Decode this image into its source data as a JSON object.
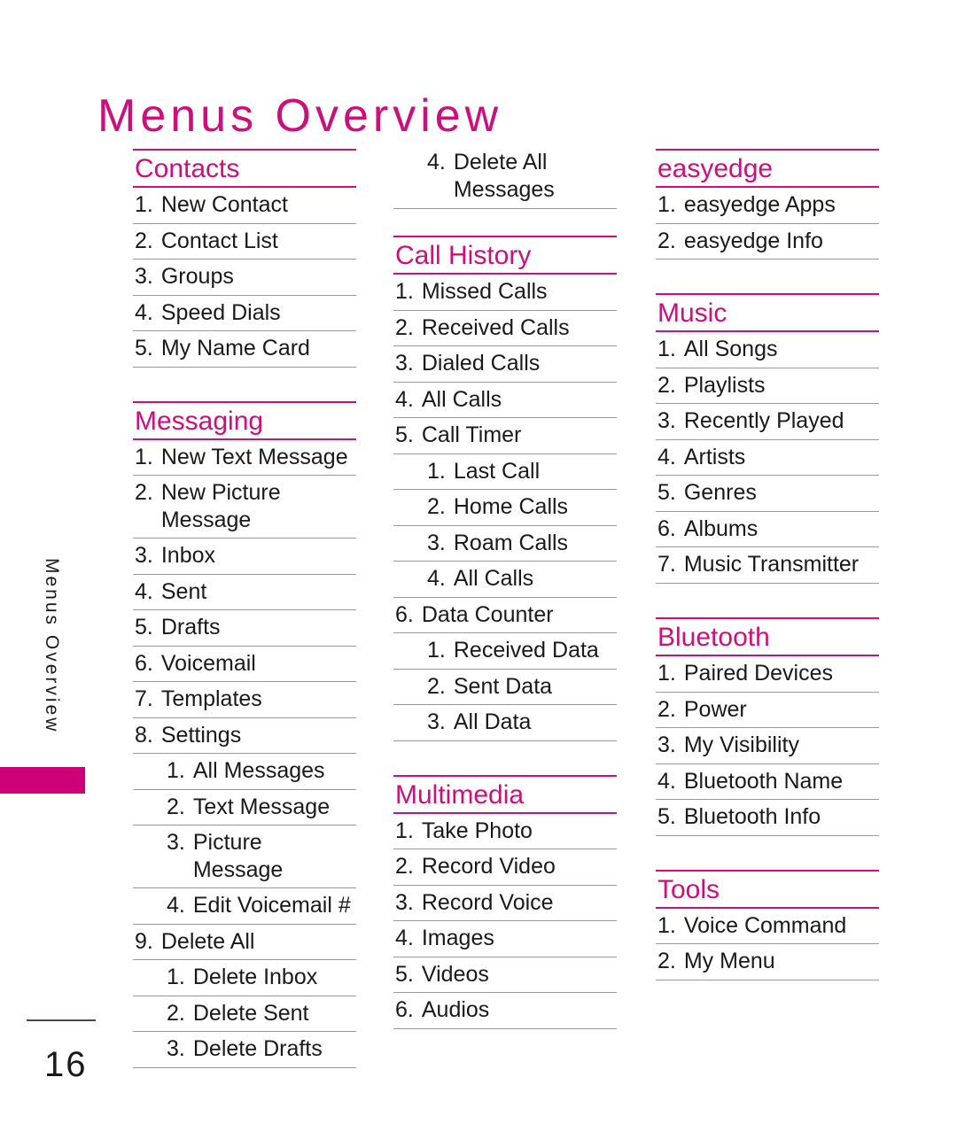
{
  "page": {
    "title": "Menus Overview",
    "side_tab_label": "Menus Overview",
    "page_number": "16",
    "accent_color": "#CE0E7D",
    "tab_color": "#CE0078",
    "rule_color": "#9a9a9a"
  },
  "columns": [
    {
      "id": "column-1",
      "groups": [
        {
          "title": "Contacts",
          "items": [
            {
              "num": "1.",
              "label": "New Contact",
              "level": 1
            },
            {
              "num": "2.",
              "label": "Contact List",
              "level": 1
            },
            {
              "num": "3.",
              "label": "Groups",
              "level": 1
            },
            {
              "num": "4.",
              "label": "Speed Dials",
              "level": 1
            },
            {
              "num": "5.",
              "label": "My Name Card",
              "level": 1
            }
          ]
        },
        {
          "title": "Messaging",
          "items": [
            {
              "num": "1.",
              "label": "New Text Message",
              "level": 1
            },
            {
              "num": "2.",
              "label": "New Picture Message",
              "level": 1
            },
            {
              "num": "3.",
              "label": "Inbox",
              "level": 1
            },
            {
              "num": "4.",
              "label": "Sent",
              "level": 1
            },
            {
              "num": "5.",
              "label": "Drafts",
              "level": 1
            },
            {
              "num": "6.",
              "label": "Voicemail",
              "level": 1
            },
            {
              "num": "7.",
              "label": "Templates",
              "level": 1
            },
            {
              "num": "8.",
              "label": "Settings",
              "level": 1
            },
            {
              "num": "1.",
              "label": "All Messages",
              "level": 2
            },
            {
              "num": "2.",
              "label": "Text Message",
              "level": 2
            },
            {
              "num": "3.",
              "label": "Picture Message",
              "level": 2
            },
            {
              "num": "4.",
              "label": "Edit Voicemail #",
              "level": 2
            },
            {
              "num": "9.",
              "label": "Delete All",
              "level": 1
            },
            {
              "num": "1.",
              "label": "Delete Inbox",
              "level": 2
            },
            {
              "num": "2.",
              "label": "Delete Sent",
              "level": 2
            },
            {
              "num": "3.",
              "label": "Delete Drafts",
              "level": 2
            }
          ]
        }
      ]
    },
    {
      "id": "column-2",
      "continued": {
        "num": "4.",
        "label": "Delete All Messages",
        "level": 2
      },
      "groups": [
        {
          "title": "Call History",
          "items": [
            {
              "num": "1.",
              "label": "Missed Calls",
              "level": 1
            },
            {
              "num": "2.",
              "label": "Received Calls",
              "level": 1
            },
            {
              "num": "3.",
              "label": "Dialed Calls",
              "level": 1
            },
            {
              "num": "4.",
              "label": "All Calls",
              "level": 1
            },
            {
              "num": "5.",
              "label": "Call Timer",
              "level": 1
            },
            {
              "num": "1.",
              "label": "Last Call",
              "level": 2
            },
            {
              "num": "2.",
              "label": "Home Calls",
              "level": 2
            },
            {
              "num": "3.",
              "label": "Roam Calls",
              "level": 2
            },
            {
              "num": "4.",
              "label": "All Calls",
              "level": 2
            },
            {
              "num": "6.",
              "label": "Data Counter",
              "level": 1
            },
            {
              "num": "1.",
              "label": "Received Data",
              "level": 2
            },
            {
              "num": "2.",
              "label": "Sent Data",
              "level": 2
            },
            {
              "num": "3.",
              "label": "All Data",
              "level": 2
            }
          ]
        },
        {
          "title": "Multimedia",
          "items": [
            {
              "num": "1.",
              "label": "Take Photo",
              "level": 1
            },
            {
              "num": "2.",
              "label": "Record Video",
              "level": 1
            },
            {
              "num": "3.",
              "label": "Record Voice",
              "level": 1
            },
            {
              "num": "4.",
              "label": "Images",
              "level": 1
            },
            {
              "num": "5.",
              "label": "Videos",
              "level": 1
            },
            {
              "num": "6.",
              "label": "Audios",
              "level": 1
            }
          ]
        }
      ]
    },
    {
      "id": "column-3",
      "groups": [
        {
          "title": "easyedge",
          "items": [
            {
              "num": "1.",
              "label": "easyedge Apps",
              "level": 1
            },
            {
              "num": "2.",
              "label": "easyedge Info",
              "level": 1
            }
          ]
        },
        {
          "title": "Music",
          "items": [
            {
              "num": "1.",
              "label": "All Songs",
              "level": 1
            },
            {
              "num": "2.",
              "label": "Playlists",
              "level": 1
            },
            {
              "num": "3.",
              "label": "Recently Played",
              "level": 1
            },
            {
              "num": "4.",
              "label": "Artists",
              "level": 1
            },
            {
              "num": "5.",
              "label": "Genres",
              "level": 1
            },
            {
              "num": "6.",
              "label": "Albums",
              "level": 1
            },
            {
              "num": "7.",
              "label": "Music Transmitter",
              "level": 1
            }
          ]
        },
        {
          "title": "Bluetooth",
          "items": [
            {
              "num": "1.",
              "label": "Paired Devices",
              "level": 1
            },
            {
              "num": "2.",
              "label": "Power",
              "level": 1
            },
            {
              "num": "3.",
              "label": "My Visibility",
              "level": 1
            },
            {
              "num": "4.",
              "label": "Bluetooth Name",
              "level": 1
            },
            {
              "num": "5.",
              "label": "Bluetooth Info",
              "level": 1
            }
          ]
        },
        {
          "title": "Tools",
          "items": [
            {
              "num": "1.",
              "label": "Voice Command",
              "level": 1
            },
            {
              "num": "2.",
              "label": "My Menu",
              "level": 1
            }
          ]
        }
      ]
    }
  ]
}
